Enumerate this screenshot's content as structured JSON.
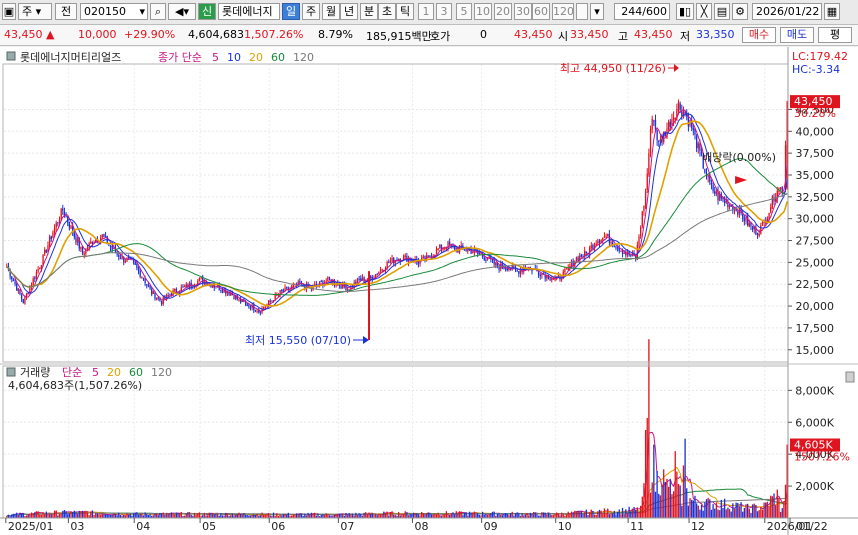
{
  "toolbar": {
    "market": "주",
    "prefix": "전",
    "code": "020150",
    "new_badge": "신",
    "name": "롯데에너지",
    "periods": [
      "일",
      "주",
      "월",
      "년",
      "분",
      "초",
      "틱"
    ],
    "intervals": [
      "1",
      "3",
      "5",
      "10",
      "20",
      "30",
      "60",
      "120"
    ],
    "count": "244",
    "count_total": "/600",
    "date": "2026/01/22"
  },
  "quote": {
    "price": "43,450",
    "change": "10,000",
    "change_pct": "+29.90%",
    "volume": "4,604,683",
    "volume_ratio": "1,507.26%",
    "turnover": "8.79%",
    "amount": "185,915백만",
    "hoga_label": "호가",
    "hoga_value": "0",
    "hoga_price": "43,450",
    "open_label": "시",
    "open": "33,450",
    "high_label": "고",
    "high": "43,450",
    "low_label": "저",
    "low": "33,350",
    "buy_label": "매수",
    "sell_label": "매도",
    "eval_label": "평"
  },
  "price_panel": {
    "title": "롯데에너지머티리얼즈",
    "legend_prefix": "종가 단순",
    "ma": [
      {
        "label": "5",
        "color": "#c71585"
      },
      {
        "label": "10",
        "color": "#1a32d8"
      },
      {
        "label": "20",
        "color": "#e0a000"
      },
      {
        "label": "60",
        "color": "#188a3a"
      },
      {
        "label": "120",
        "color": "#7a7a7a"
      }
    ],
    "lc": "LC:179.42",
    "hc": "HC:-3.34",
    "current_tag": "43,450",
    "current_pct": "30.28%",
    "high_annotation": "최고 44,950 (11/26)",
    "low_annotation": "최저 15,550 (07/10)",
    "event_annotation": "배당락(0.00%)"
  },
  "volume_panel": {
    "title": "거래량",
    "legend_prefix": "단순",
    "ma": [
      {
        "label": "5",
        "color": "#c71585"
      },
      {
        "label": "20",
        "color": "#e0a000"
      },
      {
        "label": "60",
        "color": "#188a3a"
      },
      {
        "label": "120",
        "color": "#7a7a7a"
      }
    ],
    "info": "4,604,683주(1,507.26%)",
    "current_tag": "4,605K",
    "current_pct": "1507.26%"
  },
  "chart_data": {
    "type": "candlestick",
    "price_axis": {
      "ticks": [
        15000,
        17500,
        20000,
        22500,
        25000,
        27500,
        30000,
        32500,
        35000,
        37500,
        40000,
        42500
      ],
      "tick_labels": [
        "15,000",
        "17,500",
        "20,000",
        "22,500",
        "25,000",
        "27,500",
        "30,000",
        "32,500",
        "35,000",
        "37,500",
        "40,000",
        "42,500"
      ],
      "ylim": [
        13600,
        47700
      ]
    },
    "volume_axis": {
      "ticks": [
        2000,
        4000,
        6000,
        8000
      ],
      "tick_labels": [
        "2,000K",
        "4,000K",
        "6,000K",
        "8,000K"
      ],
      "ylim": [
        0,
        9400
      ]
    },
    "months": [
      "2025/01",
      "03",
      "04",
      "05",
      "06",
      "07",
      "08",
      "09",
      "10",
      "11",
      "12",
      "2026/01",
      "01/22"
    ],
    "month_index": [
      0,
      38,
      78,
      118,
      160,
      202,
      247,
      289,
      334,
      378,
      415,
      461,
      511
    ],
    "close_anchors": [
      [
        0,
        24500
      ],
      [
        5,
        22500
      ],
      [
        10,
        20500
      ],
      [
        16,
        23000
      ],
      [
        22,
        25500
      ],
      [
        28,
        28500
      ],
      [
        34,
        31000
      ],
      [
        40,
        28500
      ],
      [
        46,
        26000
      ],
      [
        52,
        27500
      ],
      [
        58,
        28000
      ],
      [
        64,
        26500
      ],
      [
        70,
        25500
      ],
      [
        76,
        25000
      ],
      [
        82,
        23500
      ],
      [
        88,
        21500
      ],
      [
        94,
        20500
      ],
      [
        100,
        21500
      ],
      [
        106,
        22000
      ],
      [
        112,
        22500
      ],
      [
        118,
        23000
      ],
      [
        124,
        22500
      ],
      [
        130,
        22000
      ],
      [
        136,
        21500
      ],
      [
        142,
        20500
      ],
      [
        148,
        20000
      ],
      [
        154,
        19500
      ],
      [
        160,
        20500
      ],
      [
        166,
        21500
      ],
      [
        172,
        22000
      ],
      [
        178,
        22500
      ],
      [
        184,
        22000
      ],
      [
        190,
        22500
      ],
      [
        196,
        23000
      ],
      [
        202,
        22500
      ],
      [
        208,
        22000
      ],
      [
        214,
        23000
      ],
      [
        220,
        23000
      ],
      [
        226,
        24000
      ],
      [
        232,
        25000
      ],
      [
        238,
        25500
      ],
      [
        244,
        25500
      ],
      [
        250,
        25000
      ],
      [
        256,
        25500
      ],
      [
        262,
        26500
      ],
      [
        268,
        27000
      ],
      [
        274,
        26500
      ],
      [
        280,
        26500
      ],
      [
        286,
        26000
      ],
      [
        292,
        25500
      ],
      [
        298,
        24500
      ],
      [
        304,
        24500
      ],
      [
        310,
        24000
      ],
      [
        316,
        24500
      ],
      [
        322,
        24000
      ],
      [
        328,
        23500
      ],
      [
        334,
        23000
      ],
      [
        340,
        24000
      ],
      [
        346,
        25500
      ],
      [
        352,
        26000
      ],
      [
        358,
        27500
      ],
      [
        364,
        28000
      ],
      [
        370,
        27000
      ],
      [
        376,
        26000
      ],
      [
        382,
        25500
      ],
      [
        388,
        33000
      ],
      [
        392,
        42000
      ],
      [
        396,
        38500
      ],
      [
        400,
        40000
      ],
      [
        404,
        41500
      ],
      [
        408,
        43000
      ],
      [
        412,
        42000
      ],
      [
        416,
        40500
      ],
      [
        420,
        38000
      ],
      [
        424,
        35500
      ],
      [
        428,
        33500
      ],
      [
        432,
        32500
      ],
      [
        436,
        32000
      ],
      [
        440,
        31500
      ],
      [
        444,
        31000
      ],
      [
        448,
        30000
      ],
      [
        452,
        29000
      ],
      [
        456,
        28500
      ],
      [
        460,
        29500
      ],
      [
        464,
        31500
      ],
      [
        468,
        33500
      ],
      [
        472,
        33400
      ],
      [
        474,
        43450
      ]
    ],
    "volume_anchors": [
      [
        0,
        200
      ],
      [
        20,
        300
      ],
      [
        40,
        350
      ],
      [
        80,
        250
      ],
      [
        120,
        250
      ],
      [
        160,
        230
      ],
      [
        200,
        220
      ],
      [
        230,
        280
      ],
      [
        250,
        300
      ],
      [
        290,
        280
      ],
      [
        334,
        250
      ],
      [
        360,
        400
      ],
      [
        384,
        500
      ],
      [
        386,
        900
      ],
      [
        388,
        3800
      ],
      [
        389,
        5800
      ],
      [
        390,
        8300
      ],
      [
        391,
        3000
      ],
      [
        392,
        4200
      ],
      [
        394,
        2200
      ],
      [
        396,
        2500
      ],
      [
        398,
        3000
      ],
      [
        400,
        1800
      ],
      [
        402,
        2300
      ],
      [
        404,
        1200
      ],
      [
        406,
        3200
      ],
      [
        408,
        1500
      ],
      [
        410,
        1300
      ],
      [
        412,
        4000
      ],
      [
        414,
        1200
      ],
      [
        420,
        900
      ],
      [
        430,
        900
      ],
      [
        440,
        800
      ],
      [
        450,
        600
      ],
      [
        460,
        700
      ],
      [
        464,
        1100
      ],
      [
        468,
        1400
      ],
      [
        470,
        600
      ],
      [
        472,
        800
      ],
      [
        474,
        4605
      ]
    ],
    "bars": 475
  }
}
